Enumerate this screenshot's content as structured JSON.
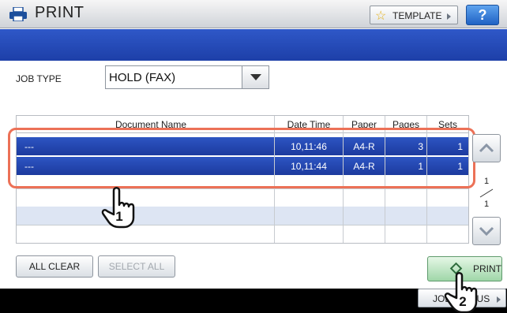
{
  "header": {
    "title": "PRINT",
    "template_label": "TEMPLATE",
    "help_label": "?"
  },
  "job_type": {
    "label": "JOB TYPE",
    "selected": "HOLD (FAX)"
  },
  "table": {
    "columns": [
      "Document Name",
      "Date Time",
      "Paper",
      "Pages",
      "Sets"
    ],
    "rows": [
      {
        "name": "---",
        "datetime": "10,11:46",
        "paper": "A4-R",
        "pages": "3",
        "sets": "1"
      },
      {
        "name": "---",
        "datetime": "10,11:44",
        "paper": "A4-R",
        "pages": "1",
        "sets": "1"
      }
    ]
  },
  "pager": {
    "current": "1",
    "total": "1"
  },
  "buttons": {
    "all_clear": "ALL CLEAR",
    "select_all": "SELECT ALL",
    "print": "PRINT",
    "job_status": "JOB STATUS"
  },
  "callouts": {
    "step1": "1",
    "step2": "2"
  },
  "colors": {
    "selection_blue": "#1f3fa8",
    "highlight_orange": "#ec7157",
    "print_green": "#9fd6a8"
  }
}
